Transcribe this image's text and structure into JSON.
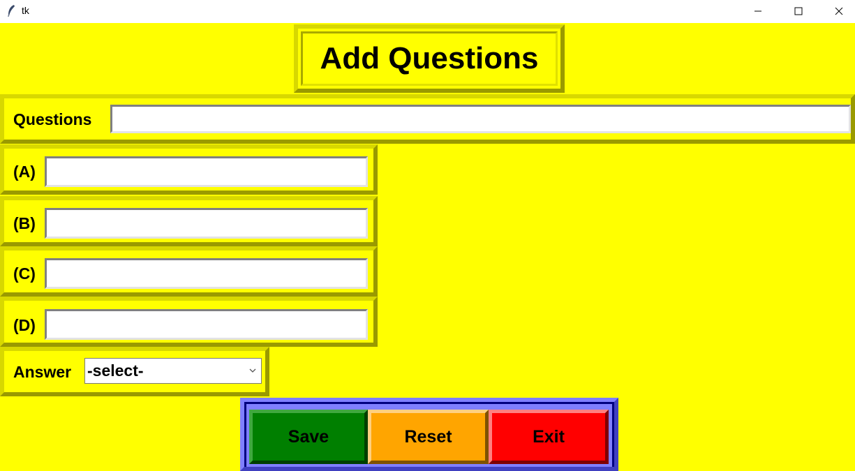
{
  "window": {
    "title": "tk",
    "minimize_icon": "minimize-icon",
    "maximize_icon": "maximize-icon",
    "close_icon": "close-icon"
  },
  "header": {
    "title": "Add Questions"
  },
  "question": {
    "label": "Questions",
    "value": ""
  },
  "options": [
    {
      "label": "(A)",
      "value": ""
    },
    {
      "label": "(B)",
      "value": ""
    },
    {
      "label": "(C)",
      "value": ""
    },
    {
      "label": "(D)",
      "value": ""
    }
  ],
  "answer": {
    "label": "Answer",
    "selected": "-select-"
  },
  "buttons": {
    "save": "Save",
    "reset": "Reset",
    "exit": "Exit"
  },
  "colors": {
    "background": "#ffff00",
    "save": "#007f00",
    "reset": "#ffa500",
    "exit": "#ff0000",
    "button_frame": "#000080"
  }
}
